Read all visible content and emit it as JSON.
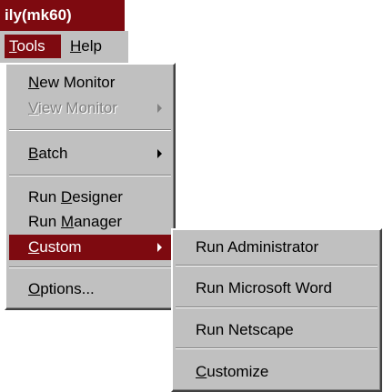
{
  "window": {
    "title": "ily(mk60)"
  },
  "menubar": {
    "tools": {
      "mnemonic": "T",
      "rest": "ools"
    },
    "help": {
      "mnemonic": "H",
      "rest": "elp"
    }
  },
  "tools_menu": {
    "new_monitor": {
      "before": "",
      "mnemonic": "N",
      "after": "ew Monitor"
    },
    "view_monitor": {
      "before": "",
      "mnemonic": "V",
      "after": "iew Monitor"
    },
    "batch": {
      "before": "",
      "mnemonic": "B",
      "after": "atch"
    },
    "run_designer": {
      "before": "Run ",
      "mnemonic": "D",
      "after": "esigner"
    },
    "run_manager": {
      "before": "Run ",
      "mnemonic": "M",
      "after": "anager"
    },
    "custom": {
      "before": "",
      "mnemonic": "C",
      "after": "ustom"
    },
    "options": {
      "before": "",
      "mnemonic": "O",
      "after": "ptions..."
    }
  },
  "custom_menu": {
    "run_administrator": "Run Administrator",
    "run_microsoft_word": "Run Microsoft Word",
    "run_netscape": "Run Netscape",
    "customize": {
      "mnemonic": "C",
      "rest": "ustomize"
    }
  },
  "colors": {
    "highlight": "#7e0a10",
    "menu_face": "#c0c0c0",
    "disabled_text": "#808080"
  },
  "icons": {
    "submenu_arrow": "right-triangle"
  }
}
